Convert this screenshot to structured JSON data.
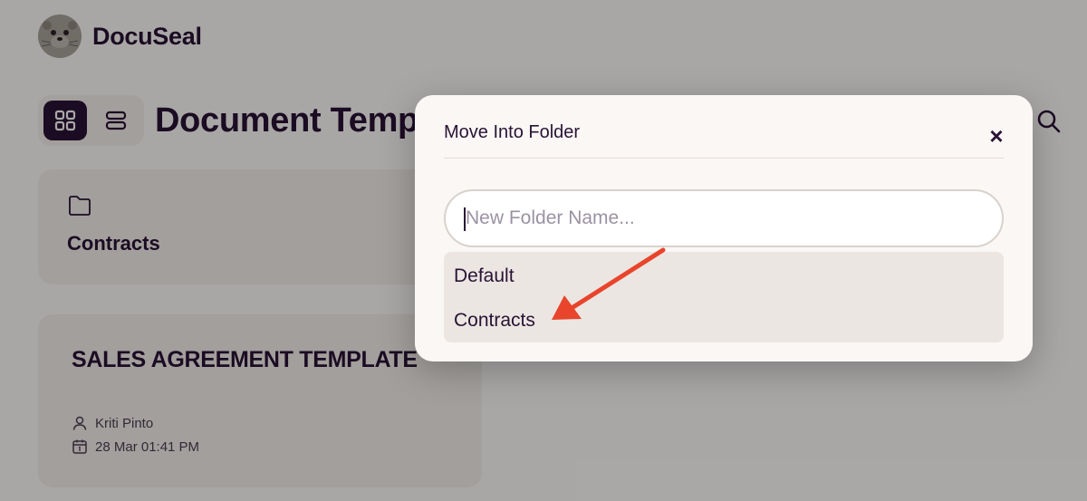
{
  "app": {
    "name": "DocuSeal"
  },
  "header": {
    "title": "Document Temp"
  },
  "folders": [
    {
      "name": "Contracts"
    }
  ],
  "templates": [
    {
      "title": "SALES AGREEMENT TEMPLATE",
      "author": "Kriti Pinto",
      "date": "28 Mar 01:41 PM"
    }
  ],
  "modal": {
    "title": "Move Into Folder",
    "close_label": "×",
    "input": {
      "placeholder": "New Folder Name...",
      "value": ""
    },
    "options": [
      "Default",
      "Contracts"
    ]
  },
  "colors": {
    "text": "#291334",
    "surface": "#faf7f5",
    "card": "#efeae6",
    "arrow": "#e8452c"
  },
  "icons": [
    "docuseal-logo",
    "grid-view-icon",
    "list-view-icon",
    "search-icon",
    "folder-icon",
    "user-icon",
    "calendar-icon",
    "close-icon",
    "arrow-annotation"
  ]
}
